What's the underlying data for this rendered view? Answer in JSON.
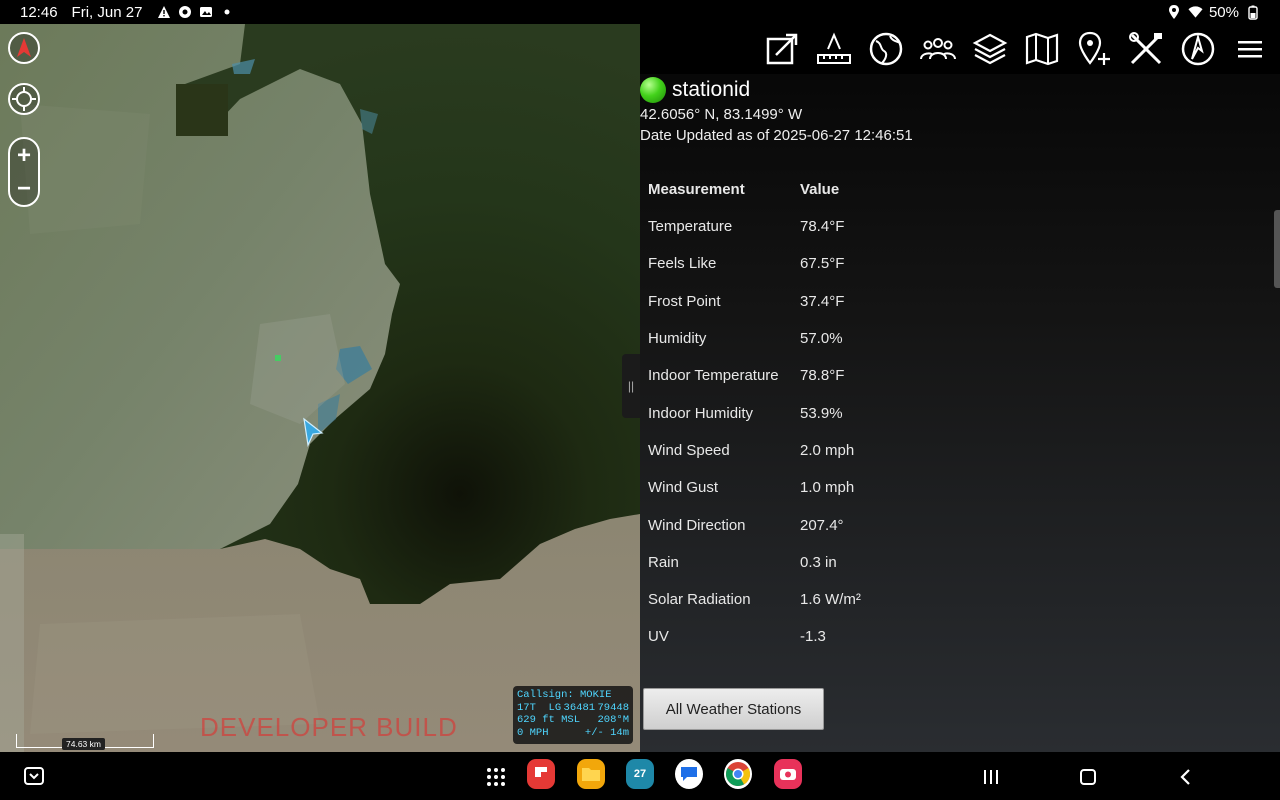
{
  "status_bar": {
    "time": "12:46",
    "date": "Fri, Jun 27",
    "battery": "50%"
  },
  "map": {
    "scale_label": "74.63 km",
    "watermark": "DEVELOPER BUILD",
    "callsign": {
      "line1": "Callsign: MOKIE",
      "zone": "17T",
      "grid": "LG",
      "easting": "36481",
      "northing": "79448",
      "altitude": "629 ft MSL",
      "heading": "208°M",
      "speed": "0 MPH",
      "accuracy": "+/- 14m"
    }
  },
  "toolbar": {
    "icons": [
      "export-icon",
      "measure-icon",
      "globe-icon",
      "team-icon",
      "layers-icon",
      "map-icon",
      "add-point-icon",
      "tools-icon",
      "compass-icon",
      "menu-icon"
    ]
  },
  "station": {
    "name": "stationid",
    "coords": "42.6056° N, 83.1499° W",
    "updated": "Date Updated as of 2025-06-27 12:46:51",
    "status_color": "#43d21b"
  },
  "table": {
    "header_measurement": "Measurement",
    "header_value": "Value",
    "rows": [
      {
        "label": "Temperature",
        "value": "78.4°F"
      },
      {
        "label": "Feels Like",
        "value": "67.5°F"
      },
      {
        "label": "Frost Point",
        "value": "37.4°F"
      },
      {
        "label": "Humidity",
        "value": "57.0%"
      },
      {
        "label": "Indoor Temperature",
        "value": "78.8°F"
      },
      {
        "label": "Indoor Humidity",
        "value": "53.9%"
      },
      {
        "label": "Wind Speed",
        "value": "2.0 mph"
      },
      {
        "label": "Wind Gust",
        "value": "1.0 mph"
      },
      {
        "label": "Wind Direction",
        "value": "207.4°"
      },
      {
        "label": "Rain",
        "value": "0.3 in"
      },
      {
        "label": "Solar Radiation",
        "value": "1.6 W/m²"
      },
      {
        "label": "UV",
        "value": "-1.3"
      }
    ]
  },
  "buttons": {
    "all_stations": "All Weather Stations"
  },
  "nav_bar": {
    "calendar_day": "27"
  },
  "colors": {
    "callsign_text": "#4fd6ff",
    "watermark": "#e62828",
    "north_arrow": "#e53935"
  }
}
